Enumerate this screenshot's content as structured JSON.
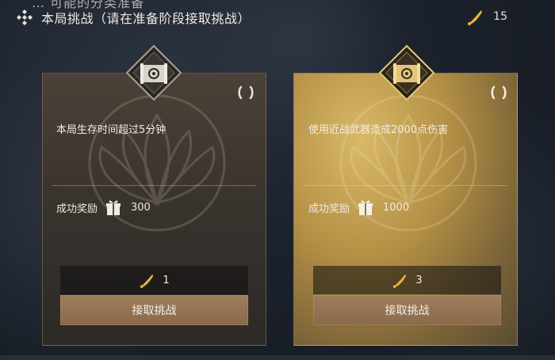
{
  "top_cutoff_text": "… 可能的分类准备",
  "header": {
    "title": "本局挑战（请在准备阶段接取挑战）",
    "icon": "diamond-cross-icon"
  },
  "currency": {
    "count": "15",
    "icon": "horn-icon",
    "color": "#e6b43c"
  },
  "cards": [
    {
      "task": "本局生存时间超过5分钟",
      "reward_label": "成功奖励",
      "reward_value": "300",
      "cost": "1",
      "button": "接取挑战",
      "theme": "dark"
    },
    {
      "task": "使用近战武器造成2000点伤害",
      "reward_label": "成功奖励",
      "reward_value": "1000",
      "cost": "3",
      "button": "接取挑战",
      "theme": "gold"
    }
  ],
  "colors": {
    "accent_gold": "#e6b43c",
    "button": "#9d7d5b"
  }
}
